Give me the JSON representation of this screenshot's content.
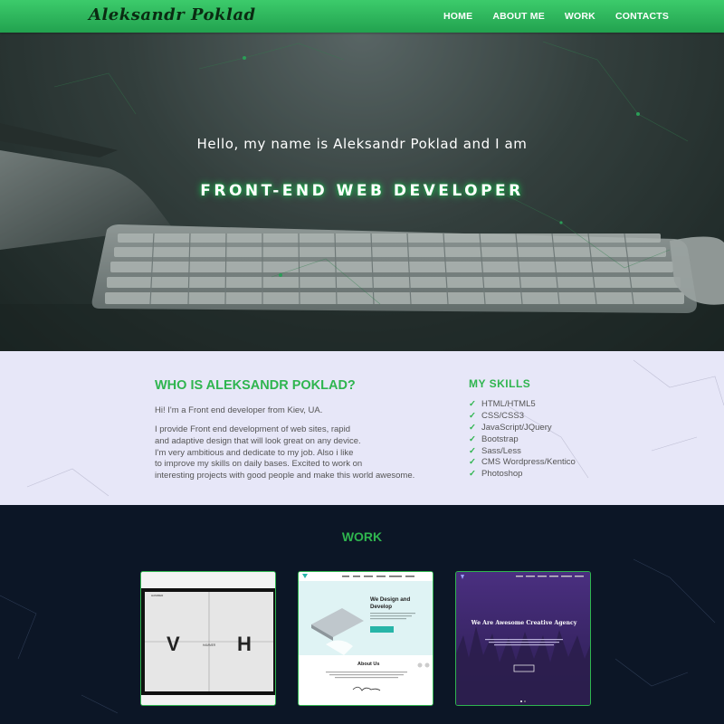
{
  "header": {
    "logo": "Aleksandr Poklad",
    "nav": [
      "HOME",
      "ABOUT ME",
      "WORK",
      "CONTACTS"
    ]
  },
  "hero": {
    "subtitle": "Hello, my name is Aleksandr Poklad and I am",
    "title": "FRONT-END WEB DEVELOPER"
  },
  "about": {
    "heading": "WHO IS ALEKSANDR POKLAD?",
    "intro": "Hi! I'm a Front end developer from Kiev, UA.",
    "body_lines": [
      "I provide Front end development of web sites, rapid",
      "and adaptive design that will look great on any device.",
      "I'm very ambitious and dedicate to my job. Also i like",
      "to improve my skills on daily bases. Excited to work on",
      "interesting projects with good people and make this world awesome."
    ]
  },
  "skills": {
    "heading": "MY SKILLS",
    "items": [
      "HTML/HTML5",
      "CSS/CSS3",
      "JavaScript/JQuery",
      "Bootstrap",
      "Sass/Less",
      "CMS Wordpress/Kentico",
      "Photoshop"
    ]
  },
  "work": {
    "heading": "WORK",
    "cards": [
      {
        "name": "Hammer",
        "logo_letters": [
          "V",
          "H"
        ],
        "tagline": "HAMMER"
      },
      {
        "name": "Design",
        "hero_text": "We Design and Develop",
        "section_title": "About Us"
      },
      {
        "name": "Creative Agency",
        "hero_text": "We Are Awesome Creative Agency"
      }
    ]
  },
  "colors": {
    "accent": "#2fb54f",
    "nav_bg": "#27a852",
    "about_bg": "#e7e7f8",
    "work_bg": "#0c1626"
  }
}
